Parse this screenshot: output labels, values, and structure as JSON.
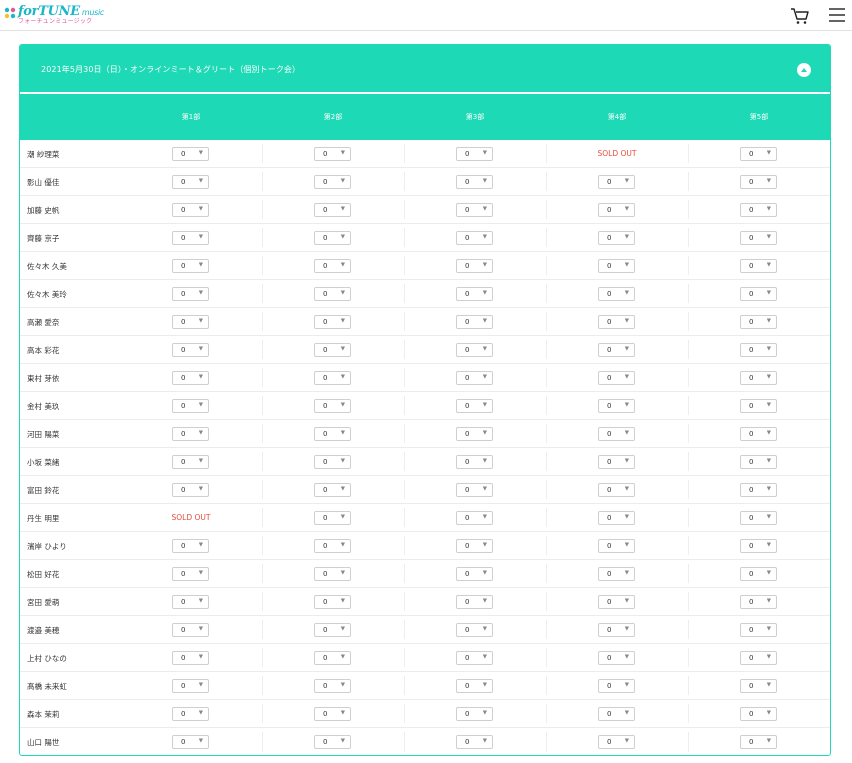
{
  "header": {
    "logo_main": "forTUNE",
    "logo_music": "music",
    "logo_sub": "フォーチュンミュージック",
    "icons": {
      "cart": "cart-icon",
      "menu": "hamburger-menu-icon"
    }
  },
  "colors": {
    "accent": "#1dd9b5",
    "soldout": "#e74c3c",
    "logo_blue": "#1bb6c9",
    "logo_pink": "#e0559d"
  },
  "event": {
    "title": "2021年5月30日（日）・オンラインミート＆グリート（個別トーク会）",
    "collapse_icon": "chevron-up-icon",
    "parts": [
      "第1部",
      "第2部",
      "第3部",
      "第4部",
      "第5部"
    ],
    "soldout_label": "SOLD OUT",
    "members": [
      {
        "name": "潮 紗理菜",
        "values": [
          "0",
          "0",
          "0",
          "SOLD OUT",
          "0"
        ]
      },
      {
        "name": "影山 優佳",
        "values": [
          "0",
          "0",
          "0",
          "0",
          "0"
        ]
      },
      {
        "name": "加藤 史帆",
        "values": [
          "0",
          "0",
          "0",
          "0",
          "0"
        ]
      },
      {
        "name": "齊藤 京子",
        "values": [
          "0",
          "0",
          "0",
          "0",
          "0"
        ]
      },
      {
        "name": "佐々木 久美",
        "values": [
          "0",
          "0",
          "0",
          "0",
          "0"
        ]
      },
      {
        "name": "佐々木 美玲",
        "values": [
          "0",
          "0",
          "0",
          "0",
          "0"
        ]
      },
      {
        "name": "高瀬 愛奈",
        "values": [
          "0",
          "0",
          "0",
          "0",
          "0"
        ]
      },
      {
        "name": "高本 彩花",
        "values": [
          "0",
          "0",
          "0",
          "0",
          "0"
        ]
      },
      {
        "name": "東村 芽依",
        "values": [
          "0",
          "0",
          "0",
          "0",
          "0"
        ]
      },
      {
        "name": "金村 美玖",
        "values": [
          "0",
          "0",
          "0",
          "0",
          "0"
        ]
      },
      {
        "name": "河田 陽菜",
        "values": [
          "0",
          "0",
          "0",
          "0",
          "0"
        ]
      },
      {
        "name": "小坂 菜緒",
        "values": [
          "0",
          "0",
          "0",
          "0",
          "0"
        ]
      },
      {
        "name": "富田 鈴花",
        "values": [
          "0",
          "0",
          "0",
          "0",
          "0"
        ]
      },
      {
        "name": "丹生 明里",
        "values": [
          "SOLD OUT",
          "0",
          "0",
          "0",
          "0"
        ]
      },
      {
        "name": "濱岸 ひより",
        "values": [
          "0",
          "0",
          "0",
          "0",
          "0"
        ]
      },
      {
        "name": "松田 好花",
        "values": [
          "0",
          "0",
          "0",
          "0",
          "0"
        ]
      },
      {
        "name": "宮田 愛萌",
        "values": [
          "0",
          "0",
          "0",
          "0",
          "0"
        ]
      },
      {
        "name": "渡邉 美穂",
        "values": [
          "0",
          "0",
          "0",
          "0",
          "0"
        ]
      },
      {
        "name": "上村 ひなの",
        "values": [
          "0",
          "0",
          "0",
          "0",
          "0"
        ]
      },
      {
        "name": "髙橋 未来虹",
        "values": [
          "0",
          "0",
          "0",
          "0",
          "0"
        ]
      },
      {
        "name": "森本 茉莉",
        "values": [
          "0",
          "0",
          "0",
          "0",
          "0"
        ]
      },
      {
        "name": "山口 陽世",
        "values": [
          "0",
          "0",
          "0",
          "0",
          "0"
        ]
      }
    ]
  }
}
